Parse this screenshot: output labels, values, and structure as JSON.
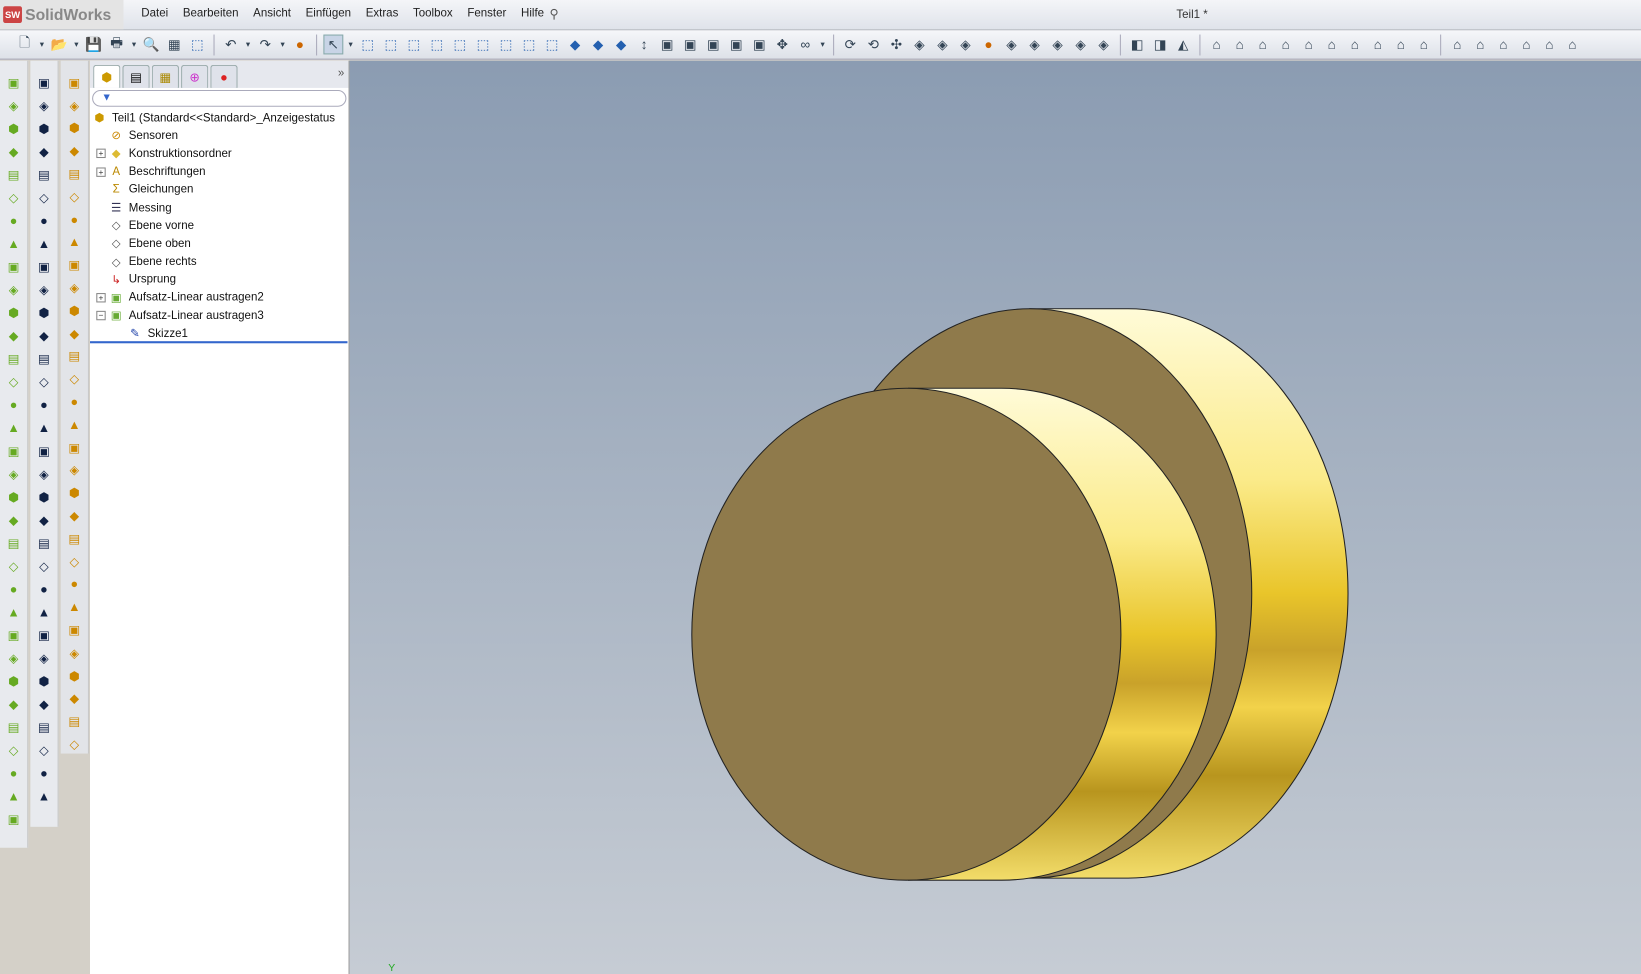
{
  "app": {
    "name": "SolidWorks",
    "logo_text": "SW",
    "document_title": "Teil1 *"
  },
  "menu": [
    "Datei",
    "Bearbeiten",
    "Ansicht",
    "Einfügen",
    "Extras",
    "Toolbox",
    "Fenster",
    "Hilfe"
  ],
  "panel": {
    "tabs": [
      "featuremanager",
      "propertymanager",
      "configurationmanager",
      "dimxpert",
      "display-manager"
    ],
    "more": "»",
    "filter_icon": "▼",
    "root": "Teil1  (Standard<<Standard>_Anzeigestatus",
    "items": [
      {
        "label": "Sensoren",
        "icon": "sensor",
        "expander": ""
      },
      {
        "label": "Konstruktionsordner",
        "icon": "folder",
        "expander": "+"
      },
      {
        "label": "Beschriftungen",
        "icon": "annotation",
        "expander": "+"
      },
      {
        "label": "Gleichungen",
        "icon": "equation",
        "expander": ""
      },
      {
        "label": "Messing",
        "icon": "material",
        "expander": ""
      },
      {
        "label": "Ebene vorne",
        "icon": "plane",
        "expander": ""
      },
      {
        "label": "Ebene oben",
        "icon": "plane",
        "expander": ""
      },
      {
        "label": "Ebene rechts",
        "icon": "plane",
        "expander": ""
      },
      {
        "label": "Ursprung",
        "icon": "origin",
        "expander": ""
      },
      {
        "label": "Aufsatz-Linear austragen2",
        "icon": "extrude",
        "expander": "+"
      },
      {
        "label": "Aufsatz-Linear austragen3",
        "icon": "extrude",
        "expander": "−"
      },
      {
        "label": "Skizze1",
        "icon": "sketch",
        "expander": "",
        "child": true
      }
    ]
  },
  "viewport": {
    "axis_label": "Y",
    "colors": {
      "face": "#8f7a4b",
      "band_light": "#fff8c8",
      "band_dark": "#b8961e"
    }
  }
}
